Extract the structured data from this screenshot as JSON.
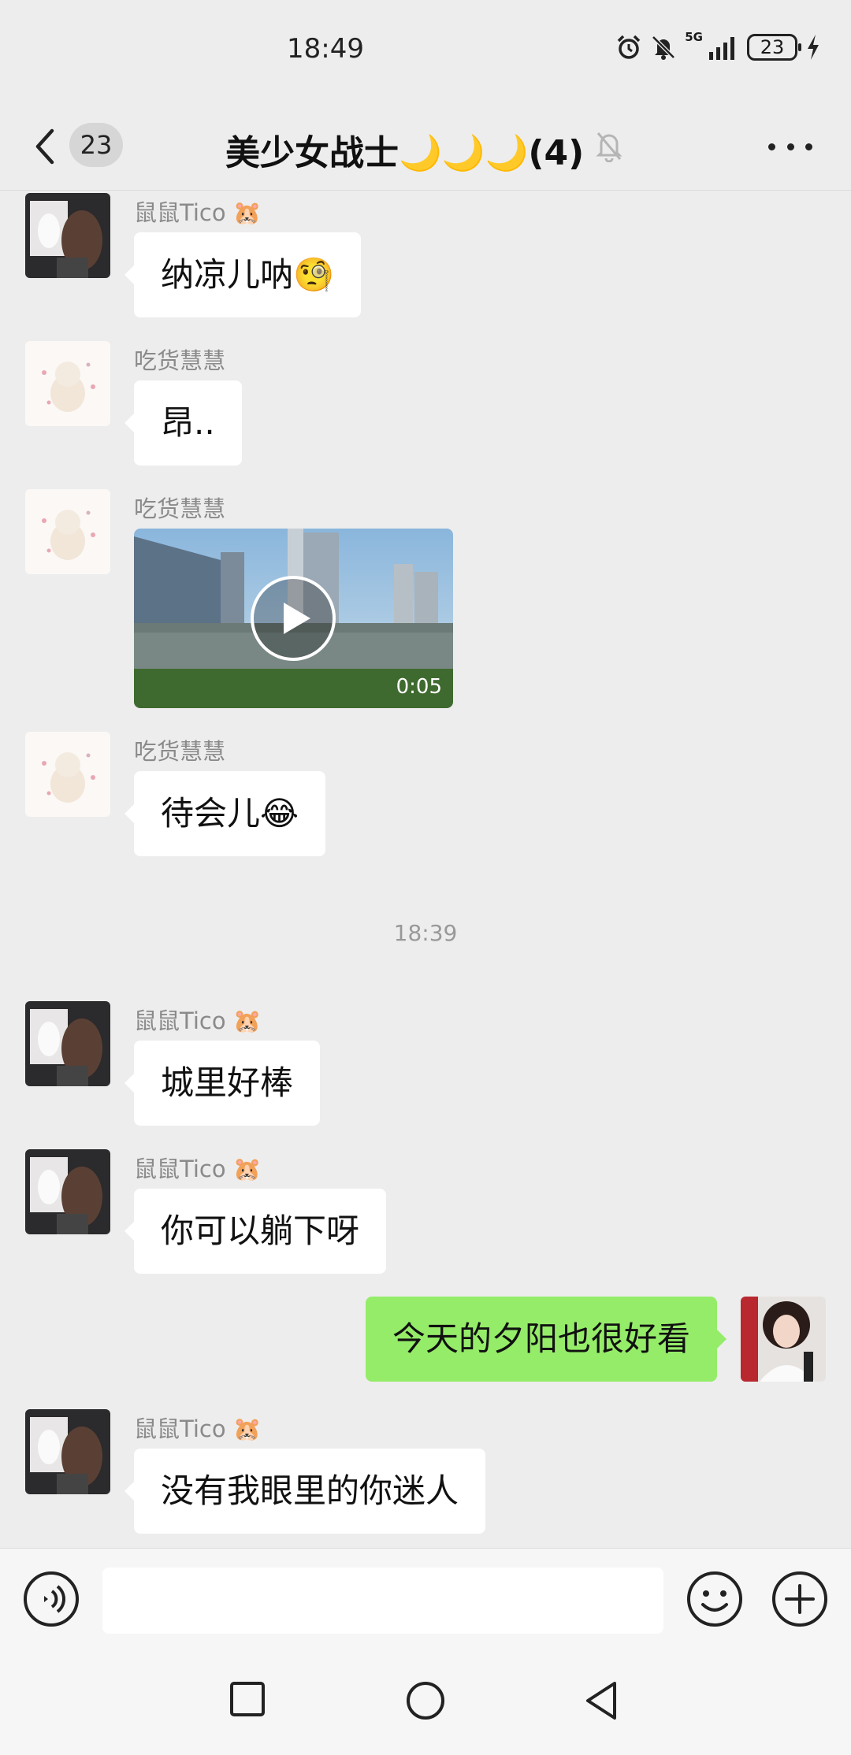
{
  "status_bar": {
    "time": "18:49",
    "network": "5G",
    "battery": "23"
  },
  "nav": {
    "unread_count": "23",
    "title": "美少女战士🌙🌙🌙(4)"
  },
  "messages": [
    {
      "type": "text",
      "sender": "鼠鼠Tico 🐹",
      "text": "纳凉儿呐🧐"
    },
    {
      "type": "text",
      "sender": "吃货慧慧",
      "text": "昂.."
    },
    {
      "type": "video",
      "sender": "吃货慧慧",
      "duration": "0:05"
    },
    {
      "type": "text",
      "sender": "吃货慧慧",
      "text": "待会儿😂"
    },
    {
      "type": "time",
      "text": "18:39"
    },
    {
      "type": "text",
      "sender": "鼠鼠Tico 🐹",
      "text": "城里好棒"
    },
    {
      "type": "text",
      "sender": "鼠鼠Tico 🐹",
      "text": "你可以躺下呀"
    },
    {
      "type": "self",
      "text": "今天的夕阳也很好看"
    },
    {
      "type": "text",
      "sender": "鼠鼠Tico 🐹",
      "text": "没有我眼里的你迷人"
    }
  ],
  "input": {
    "value": ""
  },
  "colors": {
    "background": "#ededed",
    "self_bubble": "#95ec69",
    "other_bubble": "#ffffff"
  },
  "icons": [
    "back-icon",
    "mute-bell-icon",
    "more-icon",
    "voice-icon",
    "emoji-icon",
    "plus-icon",
    "recent-apps-icon",
    "home-icon",
    "back-nav-icon",
    "alarm-icon",
    "notification-off-icon",
    "signal-icon",
    "charging-icon",
    "play-icon"
  ]
}
